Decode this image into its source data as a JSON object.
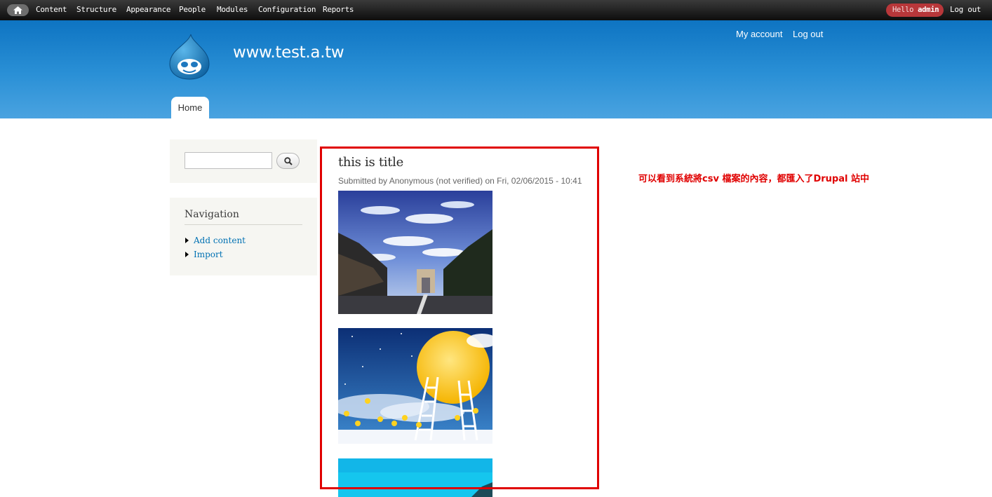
{
  "toolbar": {
    "home_icon": "home-icon",
    "menu": [
      "Content",
      "Structure",
      "Appearance",
      "People",
      "Modules",
      "Configuration",
      "Reports"
    ],
    "hello_prefix": "Hello",
    "hello_user": "admin",
    "logout": "Log out"
  },
  "header": {
    "site_name": "www.test.a.tw",
    "my_account": "My account",
    "log_out": "Log out",
    "tab_home": "Home",
    "logo_icon": "drupal-drop-icon"
  },
  "sidebar": {
    "search_icon": "magnifier-icon",
    "nav_title": "Navigation",
    "nav_items": [
      "Add content",
      "Import"
    ]
  },
  "node": {
    "title": "this is title",
    "submitted": "Submitted by Anonymous (not verified) on Fri, 02/06/2015 - 10:41",
    "images": [
      "arc-de-triomphe-avenue",
      "moon-ladders-illustration",
      "blue-sky-photo"
    ]
  },
  "annotation": "可以看到系統將csv 檔案的內容，都匯入了Drupal 站中",
  "colors": {
    "toolbar_bg": "#1a1a1a",
    "header_blue": "#1f84cc",
    "hello_badge": "#b8373a",
    "link_blue": "#0071b3",
    "annotation_red": "#e00000"
  }
}
